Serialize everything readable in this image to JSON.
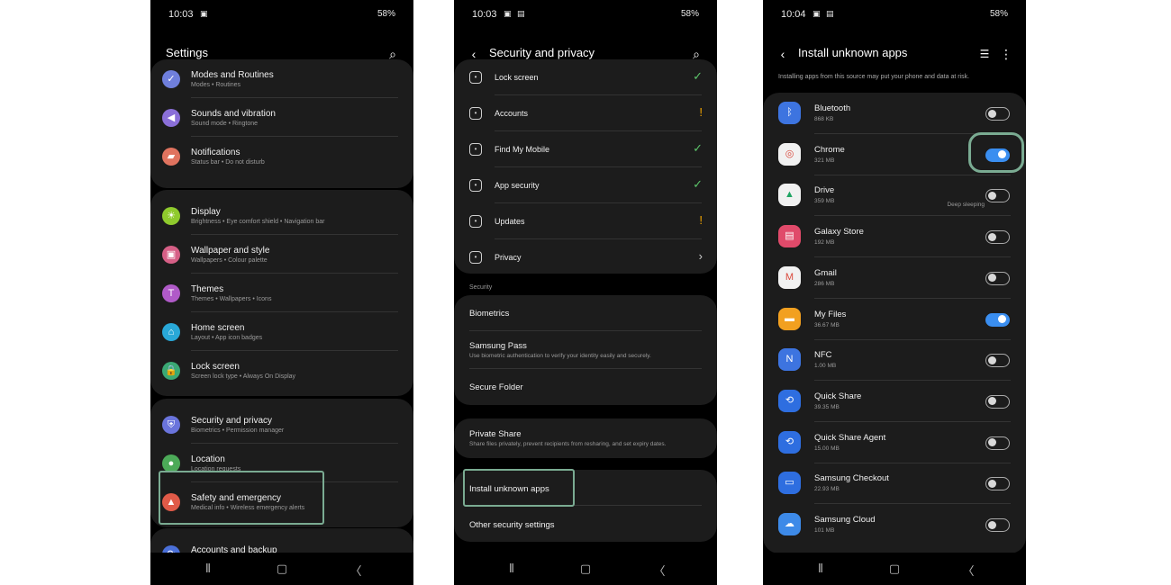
{
  "screen1": {
    "status": {
      "time": "10:03",
      "icons": "▣",
      "right": "58%"
    },
    "title": "Settings",
    "groups": [
      [
        {
          "label": "Modes and Routines",
          "sub": "Modes  •  Routines",
          "icon": "check-circle-icon",
          "glyph": "✓",
          "color": "#6f7fdc"
        },
        {
          "label": "Sounds and vibration",
          "sub": "Sound mode  •  Ringtone",
          "icon": "speaker-icon",
          "glyph": "◀",
          "color": "#8a6fd8"
        },
        {
          "label": "Notifications",
          "sub": "Status bar  •  Do not disturb",
          "icon": "bell-icon",
          "glyph": "▰",
          "color": "#e0735f"
        }
      ],
      [
        {
          "label": "Display",
          "sub": "Brightness  •  Eye comfort shield  •  Navigation bar",
          "icon": "sun-icon",
          "glyph": "☀",
          "color": "#8fca2d"
        },
        {
          "label": "Wallpaper and style",
          "sub": "Wallpapers  •  Colour palette",
          "icon": "wallpaper-icon",
          "glyph": "▣",
          "color": "#d65f86"
        },
        {
          "label": "Themes",
          "sub": "Themes  •  Wallpapers  •  Icons",
          "icon": "theme-brush-icon",
          "glyph": "T",
          "color": "#b05ac8"
        },
        {
          "label": "Home screen",
          "sub": "Layout  •  App icon badges",
          "icon": "home-icon",
          "glyph": "⌂",
          "color": "#29a8d8"
        },
        {
          "label": "Lock screen",
          "sub": "Screen lock type  •  Always On Display",
          "icon": "lock-icon",
          "glyph": "🔒",
          "color": "#3aa874"
        }
      ],
      [
        {
          "label": "Security and privacy",
          "sub": "Biometrics  •  Permission manager",
          "icon": "shield-icon",
          "glyph": "⛨",
          "color": "#6a74dc"
        },
        {
          "label": "Location",
          "sub": "Location requests",
          "icon": "location-pin-icon",
          "glyph": "●",
          "color": "#4caa58"
        },
        {
          "label": "Safety and emergency",
          "sub": "Medical info  •  Wireless emergency alerts",
          "icon": "emergency-icon",
          "glyph": "▲",
          "color": "#e05a48"
        }
      ],
      [
        {
          "label": "Accounts and backup",
          "sub": "Manage accounts  •  Smart Switch",
          "icon": "sync-icon",
          "glyph": "⟳",
          "color": "#4a6fd8"
        }
      ]
    ]
  },
  "screen2": {
    "status": {
      "time": "10:03",
      "icons": "▣ ▤",
      "right": "58%"
    },
    "title": "Security and privacy",
    "list": [
      {
        "label": "Lock screen",
        "icon": "lock-screen-icon",
        "status": "ok"
      },
      {
        "label": "Accounts",
        "icon": "account-icon",
        "status": "warn"
      },
      {
        "label": "Find My Mobile",
        "icon": "find-mobile-icon",
        "status": "ok"
      },
      {
        "label": "App security",
        "icon": "app-security-icon",
        "status": "ok"
      },
      {
        "label": "Updates",
        "icon": "updates-icon",
        "status": "warn"
      },
      {
        "label": "Privacy",
        "icon": "privacy-icon",
        "status": "chev"
      }
    ],
    "section_label": "Security",
    "security": [
      {
        "label": "Biometrics",
        "sub": ""
      },
      {
        "label": "Samsung Pass",
        "sub": "Use biometric authentication to verify your identity easily and securely."
      },
      {
        "label": "Secure Folder",
        "sub": ""
      }
    ],
    "private_share": {
      "label": "Private Share",
      "sub": "Share files privately, prevent recipients from resharing, and set expiry dates."
    },
    "bottom": [
      {
        "label": "Install unknown apps"
      },
      {
        "label": "Other security settings"
      }
    ]
  },
  "screen3": {
    "status": {
      "time": "10:04",
      "icons": "▣ ▤",
      "right": "58%"
    },
    "title": "Install unknown apps",
    "warning": "Installing apps from this source may put your phone and data at risk.",
    "apps": [
      {
        "name": "Bluetooth",
        "size": "868 KB",
        "on": false,
        "note": "",
        "icon": "bluetooth-icon",
        "glyph": "ᛒ",
        "color": "#3d74e0"
      },
      {
        "name": "Chrome",
        "size": "321 MB",
        "on": true,
        "note": "",
        "icon": "chrome-icon",
        "glyph": "◎",
        "color": "#f1f1f1"
      },
      {
        "name": "Drive",
        "size": "359 MB",
        "on": false,
        "note": "Deep sleeping",
        "icon": "drive-icon",
        "glyph": "▲",
        "color": "#f1f1f1"
      },
      {
        "name": "Galaxy Store",
        "size": "192 MB",
        "on": false,
        "note": "",
        "icon": "galaxy-store-icon",
        "glyph": "▤",
        "color": "#e04a6a"
      },
      {
        "name": "Gmail",
        "size": "286 MB",
        "on": false,
        "note": "",
        "icon": "gmail-icon",
        "glyph": "M",
        "color": "#f1f1f1"
      },
      {
        "name": "My Files",
        "size": "36.67 MB",
        "on": true,
        "note": "",
        "icon": "folder-icon",
        "glyph": "▬",
        "color": "#f2a020"
      },
      {
        "name": "NFC",
        "size": "1.00 MB",
        "on": false,
        "note": "",
        "icon": "nfc-icon",
        "glyph": "N",
        "color": "#3d74e0"
      },
      {
        "name": "Quick Share",
        "size": "39.35 MB",
        "on": false,
        "note": "",
        "icon": "quick-share-icon",
        "glyph": "⟲",
        "color": "#2e6ee0"
      },
      {
        "name": "Quick Share Agent",
        "size": "15.00 MB",
        "on": false,
        "note": "",
        "icon": "quick-share-agent-icon",
        "glyph": "⟲",
        "color": "#2e6ee0"
      },
      {
        "name": "Samsung Checkout",
        "size": "22.93 MB",
        "on": false,
        "note": "",
        "icon": "card-icon",
        "glyph": "▭",
        "color": "#2e6ee0"
      },
      {
        "name": "Samsung Cloud",
        "size": "101 MB",
        "on": false,
        "note": "",
        "icon": "cloud-icon",
        "glyph": "☁",
        "color": "#3d8ae8"
      }
    ]
  }
}
